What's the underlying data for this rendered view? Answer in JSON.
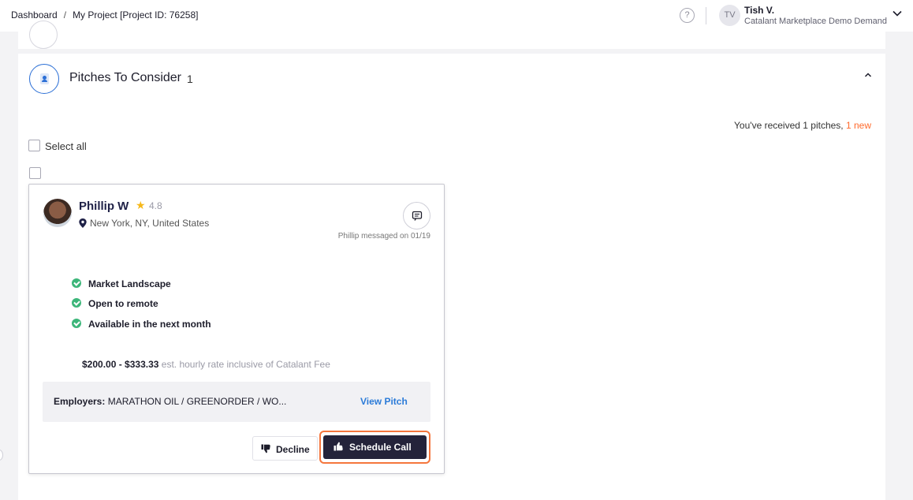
{
  "breadcrumb": {
    "home": "Dashboard",
    "separator": "/",
    "current": "My Project [Project ID: 76258]"
  },
  "user": {
    "initials": "TV",
    "name": "Tish V.",
    "org": "Catalant Marketplace Demo Demand"
  },
  "section": {
    "title": "Pitches To Consider",
    "count": "1"
  },
  "summary": {
    "text": "You've received 1 pitches, ",
    "new_text": "1 new"
  },
  "select_all_label": "Select all",
  "pitch": {
    "name": "Phillip W",
    "rating": "4.8",
    "location": "New York, NY, United States",
    "message_note": "Phillip messaged on 01/19",
    "features": [
      "Market Landscape",
      "Open to remote",
      "Available in the next month"
    ],
    "rate_value": "$200.00 - $333.33",
    "rate_note": "est. hourly rate inclusive of Catalant Fee",
    "employers_label": "Employers:",
    "employers_value": "MARATHON OIL / GREENORDER / WO...",
    "view_pitch": "View Pitch",
    "decline": "Decline",
    "schedule_call": "Schedule Call"
  },
  "colors": {
    "accent_new": "#ff6a2c",
    "link": "#2b7bd8",
    "primary_button": "#24233a",
    "highlight_ring": "#f5763d",
    "check": "#3db67a",
    "star": "#f6b81a"
  },
  "icons": [
    "help-icon",
    "chevron-down-icon",
    "pitch-section-icon",
    "chevron-up-icon",
    "star-icon",
    "location-pin-icon",
    "message-icon",
    "check-circle-icon",
    "thumbs-down-icon",
    "thumbs-up-icon"
  ]
}
